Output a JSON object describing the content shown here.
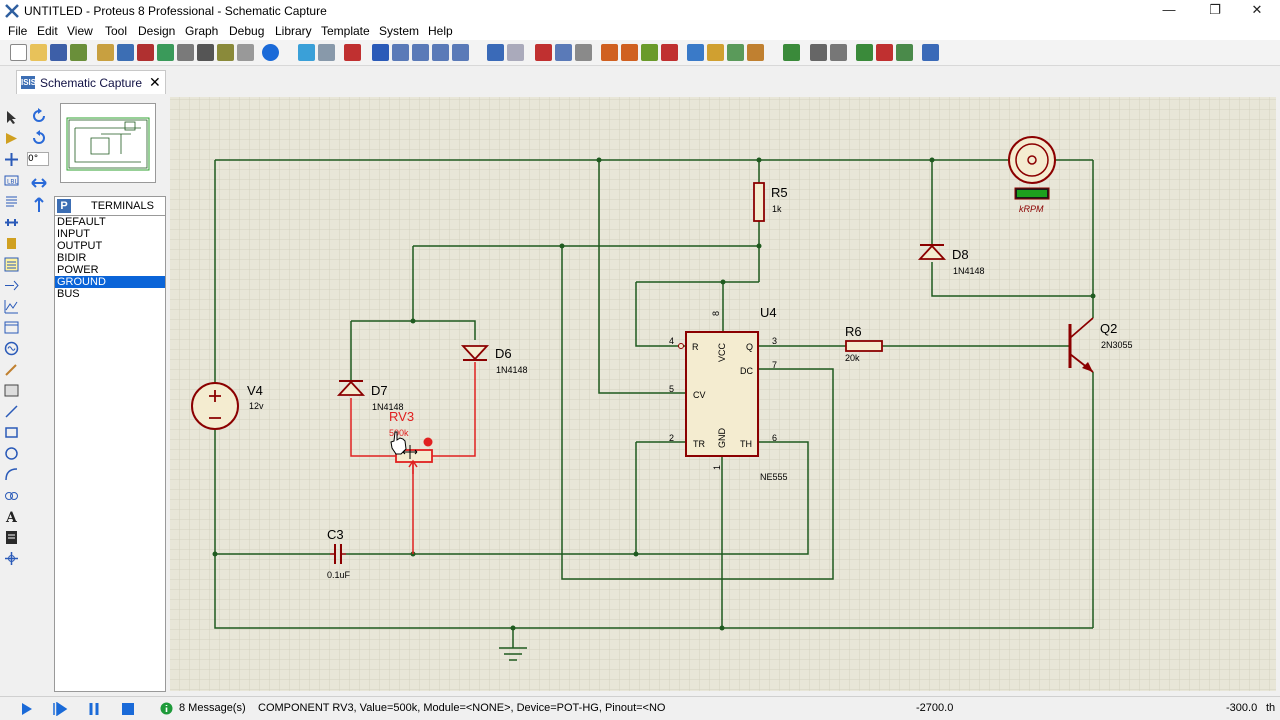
{
  "window": {
    "title": "UNTITLED - Proteus 8 Professional - Schematic Capture",
    "minimize_glyph": "—",
    "maximize_glyph": "❐",
    "close_glyph": "✕"
  },
  "menu": [
    "File",
    "Edit",
    "View",
    "Tool",
    "Design",
    "Graph",
    "Debug",
    "Library",
    "Template",
    "System",
    "Help"
  ],
  "tab": {
    "label": "Schematic Capture",
    "icon_text": "ISIS",
    "close_glyph": "✕"
  },
  "rotation": {
    "angle_value": "0°"
  },
  "terminals": {
    "selector_letter": "P",
    "header": "TERMINALS",
    "items": [
      "DEFAULT",
      "INPUT",
      "OUTPUT",
      "BIDIR",
      "POWER",
      "GROUND",
      "BUS"
    ],
    "selected": "GROUND"
  },
  "schematic": {
    "V4": {
      "ref": "V4",
      "value": "12v"
    },
    "R5": {
      "ref": "R5",
      "value": "1k"
    },
    "D8": {
      "ref": "D8",
      "value": "1N4148"
    },
    "D6": {
      "ref": "D6",
      "value": "1N4148"
    },
    "D7": {
      "ref": "D7",
      "value": "1N4148"
    },
    "RV3": {
      "ref": "RV3",
      "value": "500k"
    },
    "U4": {
      "ref": "U4",
      "type": "NE555",
      "pins": {
        "R": "R",
        "VCC": "VCC",
        "Q": "Q",
        "DC": "DC",
        "CV": "CV",
        "TR": "TR",
        "GND": "GND",
        "TH": "TH"
      },
      "pin_numbers": {
        "p4": "4",
        "p8": "8",
        "p3": "3",
        "p7": "7",
        "p5": "5",
        "p2": "2",
        "p1": "1",
        "p6": "6"
      }
    },
    "R6": {
      "ref": "R6",
      "value": "20k"
    },
    "Q2": {
      "ref": "Q2",
      "value": "2N3055"
    },
    "C3": {
      "ref": "C3",
      "value": "0.1uF"
    },
    "motor": {
      "unit": "kRPM"
    }
  },
  "status": {
    "messages": "8 Message(s)",
    "info": "COMPONENT RV3, Value=500k, Module=<NONE>, Device=POT-HG, Pinout=<NO",
    "coord_x": "-2700.0",
    "coord_y": "-300.0",
    "unit": "th"
  },
  "colors": {
    "wire": "#1f5a1f",
    "component": "#8b0000",
    "highlight": "#e02020",
    "canvas_bg": "#e8e6d8",
    "selection": "#0a64d8"
  }
}
